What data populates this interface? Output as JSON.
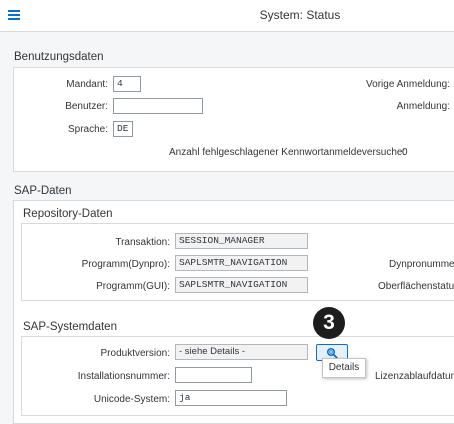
{
  "header": {
    "title": "System: Status",
    "menu_icon": "hamburger-menu-icon"
  },
  "benutzungsdaten": {
    "title": "Benutzungsdaten",
    "mandant_label": "Mandant:",
    "mandant_value": "4",
    "benutzer_label": "Benutzer:",
    "benutzer_value": "",
    "sprache_label": "Sprache:",
    "sprache_value": "DE",
    "vorige_anmeldung_label": "Vorige Anmeldung:",
    "anmeldung_label": "Anmeldung:",
    "fehlversuche_label": "Anzahl fehlgeschlagener Kennwortanmeldeversuche:",
    "fehlversuche_value": "0"
  },
  "sap_daten": {
    "title": "SAP-Daten",
    "repository": {
      "title": "Repository-Daten",
      "transaktion_label": "Transaktion:",
      "transaktion_value": "SESSION_MANAGER",
      "programm_dynpro_label": "Programm(Dynpro):",
      "programm_dynpro_value": "SAPLSMTR_NAVIGATION",
      "programm_gui_label": "Programm(GUI):",
      "programm_gui_value": "SAPLSMTR_NAVIGATION",
      "dynpronummer_label": "Dynpronummer",
      "oberflaechenstatus_label": "Oberflächenstatus"
    },
    "systemdaten": {
      "title": "SAP-Systemdaten",
      "produktversion_label": "Produktversion:",
      "produktversion_value": "- siehe Details -",
      "installationsnummer_label": "Installationsnummer:",
      "installationsnummer_value": "",
      "unicode_label": "Unicode-System:",
      "unicode_value": "ja",
      "lizenzablaufdatum_label": "Lizenzablaufdatum",
      "details_icon": "magnifier-icon",
      "details_tooltip": "Details"
    }
  },
  "annotation": {
    "step_number": "3"
  },
  "colors": {
    "accent": "#0a6ed1",
    "badge": "#1d1d1d"
  }
}
